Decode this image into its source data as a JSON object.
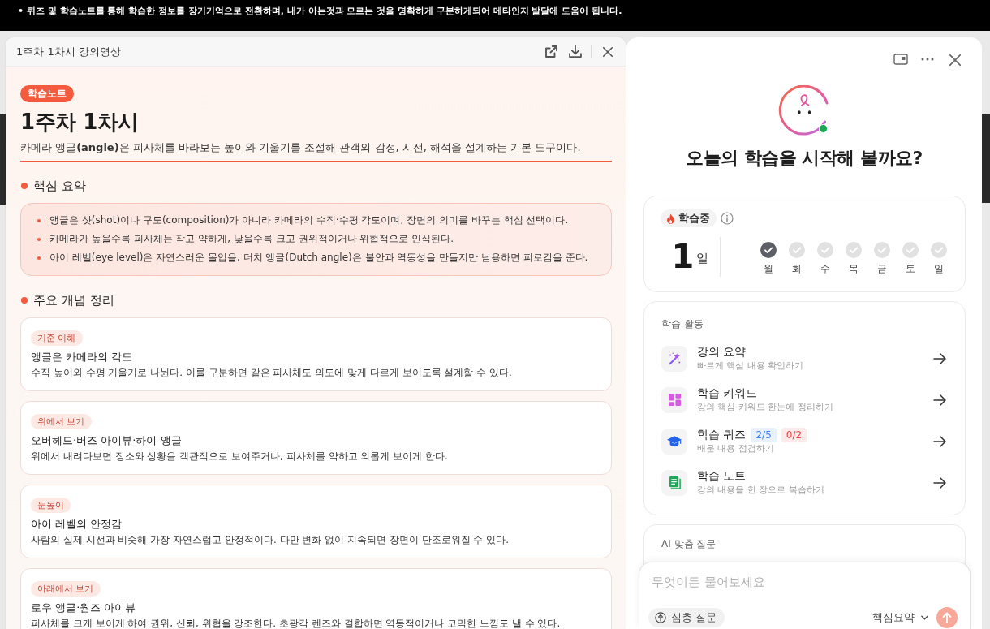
{
  "notice_bar": {
    "lines": [
      "• 퀴즈 및 학습노트를 통해 학습한 정보를 장기기억으로 전환하며, 내가 아는것과 모르는 것을 명확하게 구분하게되어 메타인지 발달에 도움이 됩니다."
    ]
  },
  "viewer": {
    "title": "1주차 1차시 강의영상",
    "badge": "학습노트",
    "heading": "1주차 1차시",
    "lead": "카메라 앵글**(angle)**은 피사체를 바라보는 높이와 기울기를 조절해 관객의 감정, 시선, 해석을 설계하는 기본 도구이다.",
    "summary": {
      "title": "핵심 요약",
      "points": [
        "앵글은 샷(shot)이나 구도(composition)가 아니라 카메라의 수직·수평 각도이며, 장면의 의미를 바꾸는 핵심 선택이다.",
        "카메라가 높을수록 피사체는 작고 약하게, 낮을수록 크고 권위적이거나 위협적으로 인식된다.",
        "아이 레벨(eye level)은 자연스러운 몰입을, 더치 앵글(Dutch angle)은 불안과 역동성을 만들지만 남용하면 피로감을 준다."
      ]
    },
    "concepts": {
      "title": "주요 개념 정리",
      "cards": [
        {
          "tag": "기준 이해",
          "title": "앵글은 카메라의 각도",
          "text": "수직 높이와 수평 기울기로 나뉜다. 이를 구분하면 같은 피사체도 의도에 맞게 다르게 보이도록 설계할 수 있다."
        },
        {
          "tag": "위에서 보기",
          "title": "오버헤드·버즈 아이뷰·하이 앵글",
          "text": "위에서 내려다보면 장소와 상황을 객관적으로 보여주거나, 피사체를 약하고 외롭게 보이게 한다."
        },
        {
          "tag": "눈높이",
          "title": "아이 레벨의 안정감",
          "text": "사람의 실제 시선과 비슷해 가장 자연스럽고 안정적이다. 다만 변화 없이 지속되면 장면이 단조로워질 수 있다."
        },
        {
          "tag": "아래에서 보기",
          "title": "로우 앵글·웜즈 아이뷰",
          "text": "피사체를 크게 보이게 하여 권위, 신뢰, 위협을 강조한다. 초광각 렌즈와 결합하면 역동적이거나 코믹한 느낌도 낼 수 있다."
        }
      ]
    }
  },
  "assistant": {
    "greeting": "오늘의 학습을 시작해 볼까요?",
    "streak": {
      "label": "학습중",
      "count": "1",
      "unit": "일",
      "days": [
        {
          "label": "월",
          "checked": true
        },
        {
          "label": "화",
          "checked": false
        },
        {
          "label": "수",
          "checked": false
        },
        {
          "label": "목",
          "checked": false
        },
        {
          "label": "금",
          "checked": false
        },
        {
          "label": "토",
          "checked": false
        },
        {
          "label": "일",
          "checked": false
        }
      ]
    },
    "activities": {
      "title": "학습 활동",
      "items": [
        {
          "kind": "summary",
          "title": "강의 요약",
          "subtitle": "빠르게 핵심 내용 확인하기"
        },
        {
          "kind": "keywords",
          "title": "학습 키워드",
          "subtitle": "강의 핵심 키워드 한눈에 정리하기"
        },
        {
          "kind": "quiz",
          "title": "학습 퀴즈",
          "badges": [
            {
              "text": "2/5",
              "color": "#3b82f6"
            },
            {
              "text": "0/2",
              "color": "#ef4444"
            }
          ],
          "subtitle": "배운 내용 점검하기"
        },
        {
          "kind": "note",
          "title": "학습 노트",
          "subtitle": "강의 내용을 한 장으로 복습하기"
        }
      ]
    },
    "ai_questions": {
      "title": "AI 맞춤 질문"
    },
    "composer": {
      "placeholder": "무엇이든 물어보세요",
      "mode_chip": "심층 질문",
      "dropdown": "핵심요약"
    }
  }
}
